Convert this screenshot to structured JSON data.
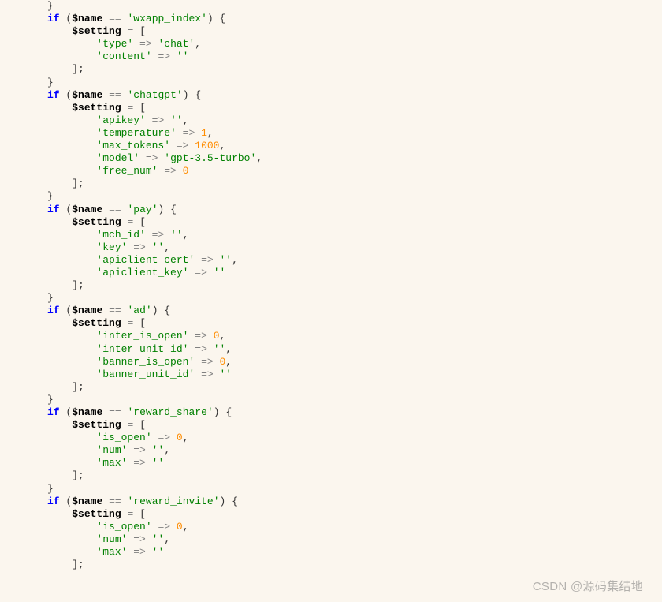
{
  "watermark": "CSDN @源码集结地",
  "tok": {
    "kw_if": "if",
    "var_name": "$name",
    "var_setting": "$setting",
    "op_eqeq": "==",
    "op_assign": "=",
    "op_arrow": "=>",
    "pn_openParen": "(",
    "pn_closeParen": ")",
    "pn_openBrace": "{",
    "pn_closeBrace": "}",
    "pn_openBracket": "[",
    "pn_closeBracket": "]",
    "pn_semi": ";",
    "pn_comma": ",",
    "s_wxapp_index": "'wxapp_index'",
    "s_type": "'type'",
    "s_chat": "'chat'",
    "s_content": "'content'",
    "s_empty": "''",
    "s_chatgpt": "'chatgpt'",
    "s_apikey": "'apikey'",
    "s_temperature": "'temperature'",
    "s_max_tokens": "'max_tokens'",
    "s_model": "'model'",
    "s_gpt": "'gpt-3.5-turbo'",
    "s_free_num": "'free_num'",
    "s_pay": "'pay'",
    "s_mch_id": "'mch_id'",
    "s_key": "'key'",
    "s_apiclient_cert": "'apiclient_cert'",
    "s_apiclient_key": "'apiclient_key'",
    "s_ad": "'ad'",
    "s_inter_is_open": "'inter_is_open'",
    "s_inter_unit_id": "'inter_unit_id'",
    "s_banner_is_open": "'banner_is_open'",
    "s_banner_unit_id": "'banner_unit_id'",
    "s_reward_share": "'reward_share'",
    "s_is_open": "'is_open'",
    "s_num": "'num'",
    "s_max": "'max'",
    "s_reward_invite": "'reward_invite'",
    "n_1": "1",
    "n_1000": "1000",
    "n_0": "0"
  }
}
